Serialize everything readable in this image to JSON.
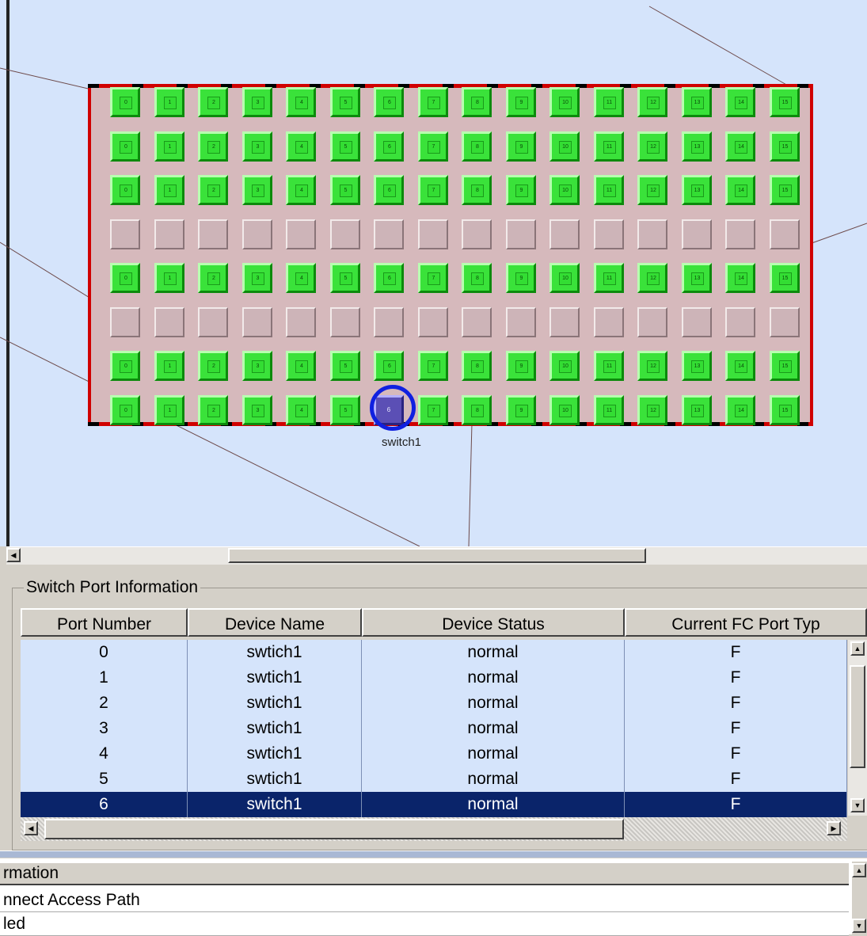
{
  "switch": {
    "name": "switch1",
    "selected_port": "6",
    "rows": [
      {
        "type": "active"
      },
      {
        "type": "active"
      },
      {
        "type": "active"
      },
      {
        "type": "empty"
      },
      {
        "type": "active"
      },
      {
        "type": "empty"
      },
      {
        "type": "active"
      },
      {
        "type": "active"
      }
    ],
    "port_labels": [
      "0",
      "1",
      "2",
      "3",
      "4",
      "5",
      "6",
      "7",
      "8",
      "9",
      "10",
      "11",
      "12",
      "13",
      "14",
      "15"
    ]
  },
  "port_info": {
    "title": "Switch Port Information",
    "columns": [
      "Port Number",
      "Device Name",
      "Device Status",
      "Current FC Port Typ"
    ],
    "rows": [
      {
        "port": "0",
        "device": "swtich1",
        "status": "normal",
        "type": "F"
      },
      {
        "port": "1",
        "device": "swtich1",
        "status": "normal",
        "type": "F"
      },
      {
        "port": "2",
        "device": "swtich1",
        "status": "normal",
        "type": "F"
      },
      {
        "port": "3",
        "device": "swtich1",
        "status": "normal",
        "type": "F"
      },
      {
        "port": "4",
        "device": "swtich1",
        "status": "normal",
        "type": "F"
      },
      {
        "port": "5",
        "device": "swtich1",
        "status": "normal",
        "type": "F"
      },
      {
        "port": "6",
        "device": "switch1",
        "status": "normal",
        "type": "F",
        "selected": true
      }
    ]
  },
  "info_panel": {
    "header": "rmation",
    "rows": [
      "nnect Access Path",
      "led"
    ]
  },
  "colors": {
    "port_active": "#3ae23a",
    "switch_border": "#d00000",
    "canvas": "#d5e4fb",
    "selection": "#0a246a"
  }
}
